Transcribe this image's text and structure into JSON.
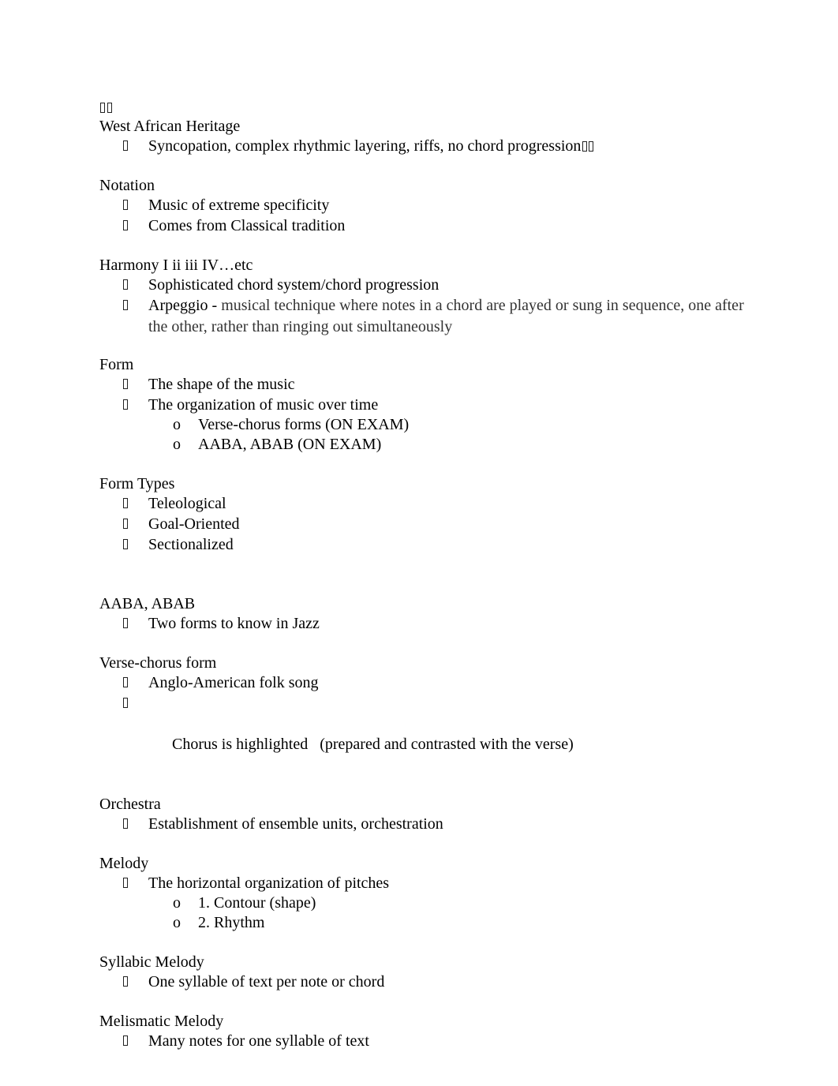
{
  "document": {
    "sections": [
      {
        "heading": "West African Heritage",
        "items": [
          {
            "text": "Syncopation, complex rhythmic layering, riffs, no chord progression"
          }
        ]
      },
      {
        "heading": "Notation",
        "items": [
          {
            "text": "Music of extreme specificity"
          },
          {
            "text": "Comes from Classical tradition"
          }
        ]
      },
      {
        "heading": "Harmony I ii iii IV…etc",
        "items": [
          {
            "text": "Sophisticated chord system/chord progression"
          },
          {
            "term": "Arpeggio - ",
            "definition": "musical technique where notes in a chord are played or sung in sequence, one after the other, rather than ringing out simultaneously"
          }
        ]
      },
      {
        "heading": "Form",
        "items": [
          {
            "text": "The shape of the music"
          },
          {
            "text": "The organization of music over time",
            "subitems": [
              "Verse-chorus forms (ON EXAM)",
              "AABA, ABAB (ON EXAM)"
            ]
          }
        ]
      },
      {
        "heading": "Form Types",
        "items": [
          {
            "text": "Teleological"
          },
          {
            "text": "Goal-Oriented"
          },
          {
            "text": "Sectionalized"
          }
        ]
      },
      {
        "heading": "AABA, ABAB",
        "items": [
          {
            "text": "Two forms to know in Jazz"
          }
        ]
      },
      {
        "heading": "Verse-chorus form",
        "items": [
          {
            "text": "Anglo-American folk song"
          },
          {
            "text": "Chorus is highlighted   (prepared and contrasted with the verse)"
          }
        ]
      },
      {
        "heading": "Orchestra",
        "items": [
          {
            "text": "Establishment of ensemble units, orchestration"
          }
        ]
      },
      {
        "heading": "Melody",
        "items": [
          {
            "text": "The horizontal organization of pitches",
            "subitems": [
              "1. Contour (shape)",
              "2. Rhythm"
            ]
          }
        ]
      },
      {
        "heading": "Syllabic Melody",
        "items": [
          {
            "text": "One syllable of text per note or chord"
          }
        ]
      },
      {
        "heading": "Melismatic Melody",
        "items": [
          {
            "text": "Many notes for one syllable of text"
          }
        ]
      }
    ],
    "sub_bullet_glyph": "o",
    "bullet_icon": "missing-glyph-box"
  }
}
